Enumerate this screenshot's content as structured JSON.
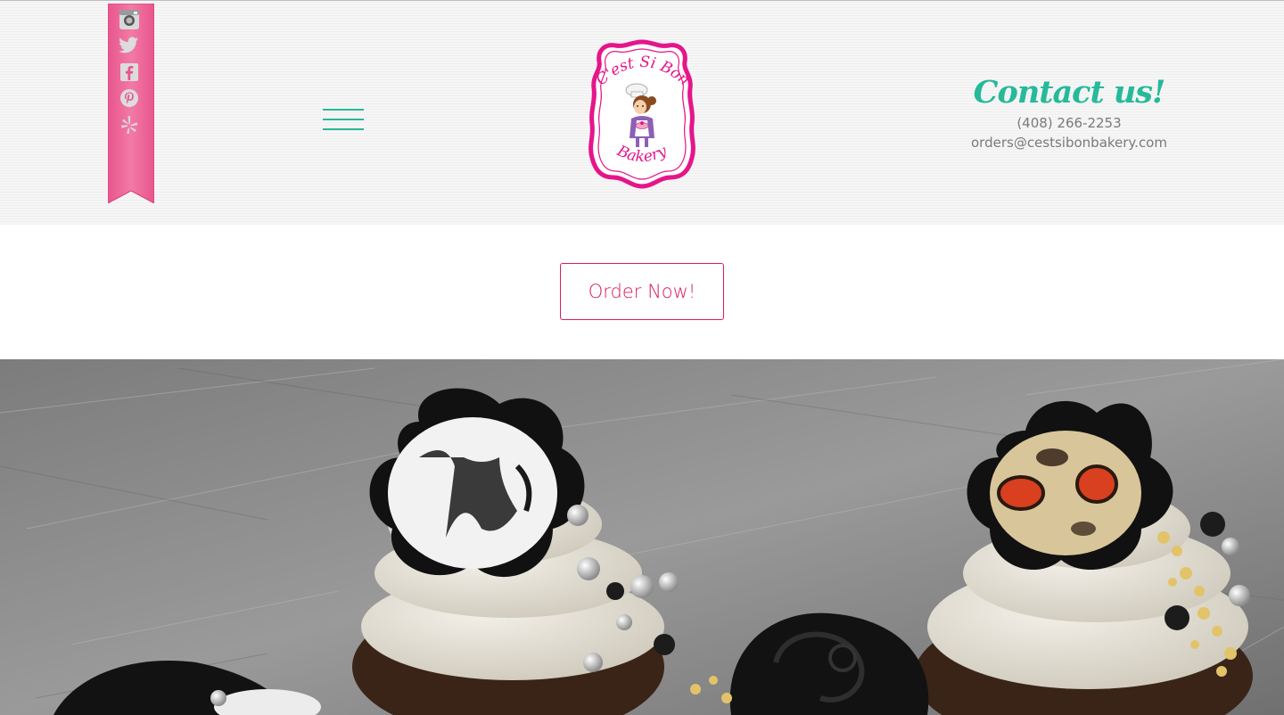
{
  "social": {
    "items": [
      {
        "name": "instagram",
        "icon": "instagram-icon"
      },
      {
        "name": "twitter",
        "icon": "twitter-icon"
      },
      {
        "name": "facebook",
        "icon": "facebook-icon"
      },
      {
        "name": "pinterest",
        "icon": "pinterest-icon"
      },
      {
        "name": "yelp",
        "icon": "yelp-icon"
      }
    ],
    "ribbon_color": "#f06a9c"
  },
  "menu": {
    "icon": "hamburger-menu-icon",
    "color": "#26b99a"
  },
  "logo": {
    "line1": "C'est Si Bon",
    "line2": "Bakery",
    "color": "#e5158a"
  },
  "contact": {
    "title": "Contact us!",
    "phone": "(408) 266-2253",
    "email": "orders@cestsibonbakery.com",
    "title_color": "#26b99a"
  },
  "cta": {
    "label": "Order Now!",
    "color": "#d81b60"
  },
  "hero": {
    "subject": "decorated cupcakes photo"
  }
}
